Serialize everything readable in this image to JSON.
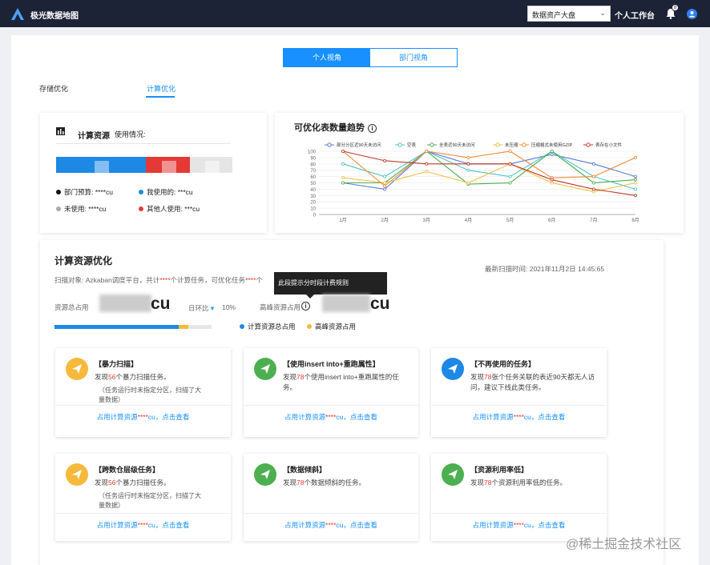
{
  "header": {
    "brand": "极光数据地图",
    "selector_value": "数据资产大盘",
    "workbench_label": "个人工作台",
    "notification_count": "8"
  },
  "view_toggle": {
    "personal": "个人视角",
    "department": "部门视角"
  },
  "subtabs": {
    "storage": "存储优化",
    "compute": "计算优化"
  },
  "usage": {
    "title": "计算资源",
    "subtitle": "使用情况:",
    "legend": [
      {
        "label": "部门预算: ****cu",
        "color": "#111111"
      },
      {
        "label": "我使用的: ***cu",
        "color": "#1e88e5"
      },
      {
        "label": "未使用: ****cu",
        "color": "#aaaaaa"
      },
      {
        "label": "其他人使用: ***cu",
        "color": "#e53935"
      }
    ],
    "segments": [
      {
        "name": "mine",
        "share": 0.51,
        "color": "#1e88e5"
      },
      {
        "name": "others",
        "share": 0.25,
        "color": "#e53935"
      },
      {
        "name": "unused",
        "share": 0.24,
        "color": "#e5e5e5"
      }
    ]
  },
  "trend": {
    "title": "可优化表数量趋势"
  },
  "chart_data": {
    "type": "line",
    "categories": [
      "1月",
      "2月",
      "3月",
      "4月",
      "5月",
      "6月",
      "7月",
      "8月"
    ],
    "ylim": [
      0,
      100
    ],
    "yticks": [
      0,
      10,
      20,
      30,
      40,
      50,
      60,
      70,
      80,
      90,
      100
    ],
    "legend_position": "top",
    "grid": true,
    "series": [
      {
        "name": "部分分区近90天未访问",
        "color": "#5b7bd5",
        "values": [
          50,
          40,
          100,
          80,
          80,
          95,
          80,
          60
        ]
      },
      {
        "name": "空表",
        "color": "#4fc3c8",
        "values": [
          80,
          60,
          100,
          70,
          60,
          100,
          60,
          40
        ]
      },
      {
        "name": "全表近90天未访问",
        "color": "#4caf50",
        "values": [
          50,
          50,
          100,
          48,
          50,
          100,
          50,
          55
        ]
      },
      {
        "name": "未压缩",
        "color": "#f0c040",
        "values": [
          58,
          50,
          68,
          50,
          80,
          50,
          36,
          50
        ]
      },
      {
        "name": "压缩格式未使用GZIP",
        "color": "#f08a3c",
        "values": [
          100,
          45,
          100,
          90,
          100,
          58,
          60,
          90
        ]
      },
      {
        "name": "表存在小文件",
        "color": "#c0392b",
        "values": [
          100,
          85,
          80,
          80,
          80,
          55,
          40,
          30
        ]
      }
    ]
  },
  "optimization": {
    "title": "计算资源优化",
    "scan_time": "最新扫描时间: 2021年11月2日 14:45:65",
    "scan_prefix": "扫描对象: Azkaban调度平台，共计",
    "scan_stars1": "****",
    "scan_mid": "个计算任务，可优化任务",
    "scan_stars2": "****",
    "scan_suffix": "个",
    "tooltip": "此段提示分时段计费规则",
    "total_label": "资源总占用",
    "total_value_suffix": "cu",
    "ring_label": "日环比",
    "ring_value": "10%",
    "peak_label": "高峰资源占用",
    "peak_value_suffix": "cu",
    "progress_total": 0.79,
    "progress_peak": 0.06,
    "legend_total": "计算资源总占用",
    "legend_peak": "高峰资源占用",
    "legend_total_color": "#1e88e5",
    "legend_peak_color": "#f6b93b"
  },
  "tiles": [
    {
      "title": "【暴力扫描】",
      "d_pre": "发现",
      "d_num": "56",
      "d_post": "个暴力扫描任务。",
      "note": "（任务运行时未指定分区，扫描了大量数据）",
      "f_pre": "占用计算资源",
      "f_stars": "****",
      "f_post": "cu，点击查看",
      "color": "#f6b93b"
    },
    {
      "title": "【使用insert into+重跑属性】",
      "d_pre": "发现",
      "d_num": "78",
      "d_post": "个使用insert into+重跑属性的任务。",
      "note": "",
      "f_pre": "占用计算资源",
      "f_stars": "****",
      "f_post": "cu，点击查看",
      "color": "#4caf50"
    },
    {
      "title": "【不再使用的任务】",
      "d_pre": "发现",
      "d_num": "78",
      "d_post": "张个任务关联的表近90天都无人访问，建议下线此类任务。",
      "note": "",
      "f_pre": "占用计算资源",
      "f_stars": "****",
      "f_post": "cu，点击查看",
      "color": "#1e88e5"
    },
    {
      "title": "【跨数仓层级任务】",
      "d_pre": "发现",
      "d_num": "56",
      "d_post": "个暴力扫描任务。",
      "note": "（任务运行时未指定分区，扫描了大量数据）",
      "f_pre": "占用计算资源",
      "f_stars": "****",
      "f_post": "cu，点击查看",
      "color": "#f6b93b"
    },
    {
      "title": "【数据倾斜】",
      "d_pre": "发现",
      "d_num": "78",
      "d_post": "个数据倾斜的任务。",
      "note": "",
      "f_pre": "占用计算资源",
      "f_stars": "****",
      "f_post": "cu，点击查看",
      "color": "#4caf50"
    },
    {
      "title": "【资源利用率低】",
      "d_pre": "发现",
      "d_num": "78",
      "d_post": "个资源利用率低的任务。",
      "note": "",
      "f_pre": "占用计算资源",
      "f_stars": "****",
      "f_post": "cu，点击查看",
      "color": "#4caf50"
    }
  ],
  "watermark": "@稀土掘金技术社区"
}
